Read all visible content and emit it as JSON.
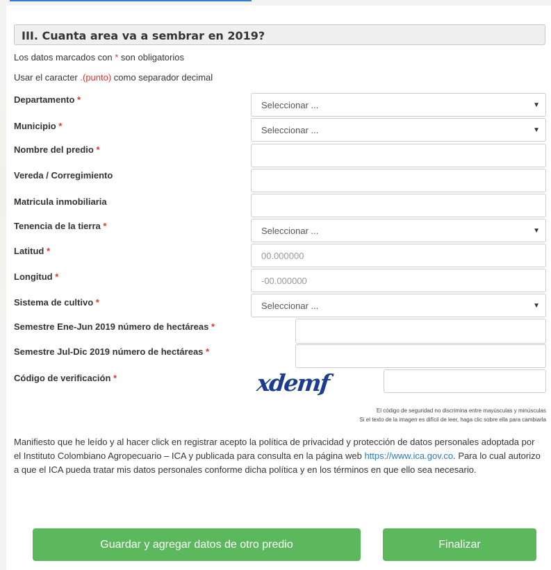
{
  "section": {
    "title": "III. Cuanta area va a sembrar en 2019?"
  },
  "notes": {
    "required_prefix": "Los datos marcados con ",
    "required_star": "*",
    "required_suffix": " son obligatorios",
    "decimal_prefix": "Usar el caracter ",
    "decimal_highlight": ".(punto)",
    "decimal_suffix": " como separador decimal"
  },
  "form": {
    "departamento": {
      "label": "Departamento",
      "value": "Seleccionar ..."
    },
    "municipio": {
      "label": "Municipio",
      "value": "Seleccionar ..."
    },
    "nombre_predio": {
      "label": "Nombre del predio",
      "value": ""
    },
    "vereda": {
      "label": "Vereda / Corregimiento",
      "value": ""
    },
    "matricula": {
      "label": "Matricula inmobiliaria",
      "value": ""
    },
    "tenencia": {
      "label": "Tenencia de la tierra",
      "value": "Seleccionar ..."
    },
    "latitud": {
      "label": "Latitud",
      "placeholder": "00.000000"
    },
    "longitud": {
      "label": "Longitud",
      "placeholder": "-00.000000"
    },
    "sistema": {
      "label": "Sistema de cultivo",
      "value": "Seleccionar ..."
    },
    "semestre1": {
      "label": "Semestre Ene-Jun 2019 número de hectáreas",
      "value": ""
    },
    "semestre2": {
      "label": "Semestre Jul-Dic 2019 número de hectáreas",
      "value": ""
    },
    "codigo": {
      "label": "Código de verificación",
      "value": ""
    },
    "required_star": "*",
    "dropdown_arrow": "▼"
  },
  "captcha": {
    "text": "xdemf",
    "note1": "El código de seguridad no discrimina entre mayúsculas y minúsculas",
    "note2": "Si el texto de la imagen es difícil de leer, haga clic sobre ella para cambiarla"
  },
  "consent": {
    "text_before": "Manifiesto que he leído y al hacer click en registrar acepto la política de privacidad y protección de datos personales adoptada por el Instituto Colombiano Agropecuario – ICA y publicada para consulta en la página web ",
    "link": "https://www.ica.gov.co",
    "text_after": ". Para lo cual autorizo a que el ICA pueda tratar mis datos personales conforme dicha política y en los términos en que ello sea necesario."
  },
  "buttons": {
    "save_add": "Guardar y agregar datos de otro predio",
    "finish": "Finalizar"
  },
  "colors": {
    "button": "#5cb85c",
    "required": "#e3342f",
    "link": "#2a7bbd",
    "captcha": "#1a3d8f"
  }
}
